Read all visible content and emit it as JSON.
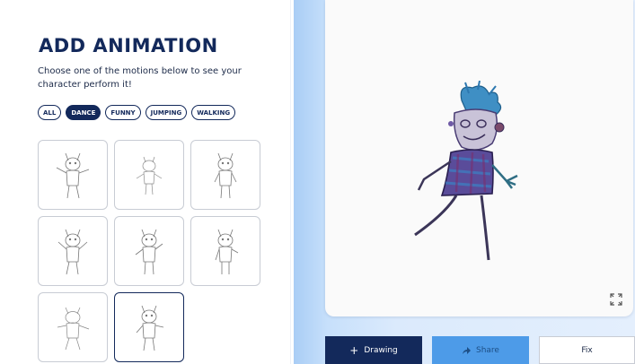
{
  "panel": {
    "title": "ADD ANIMATION",
    "subtitle": "Choose one of the motions below to see your character perform it!"
  },
  "filters": [
    {
      "label": "ALL",
      "active": false
    },
    {
      "label": "DANCE",
      "active": true
    },
    {
      "label": "FUNNY",
      "active": false
    },
    {
      "label": "JUMPING",
      "active": false
    },
    {
      "label": "WALKING",
      "active": false
    }
  ],
  "animations": {
    "count": 8,
    "selected_index": 7,
    "thumbnail_icon": "sketch-character"
  },
  "canvas": {
    "expand_icon": "expand-icon",
    "character": "drawn-character"
  },
  "actions": {
    "drawing_label": "Drawing",
    "drawing_icon": "plus-icon",
    "share_label": "Share",
    "share_icon": "share-arrow-icon",
    "fix_label": "Fix"
  },
  "colors": {
    "primary": "#13295b",
    "share": "#4d9be8",
    "background_blue": "#c7e0fb"
  }
}
